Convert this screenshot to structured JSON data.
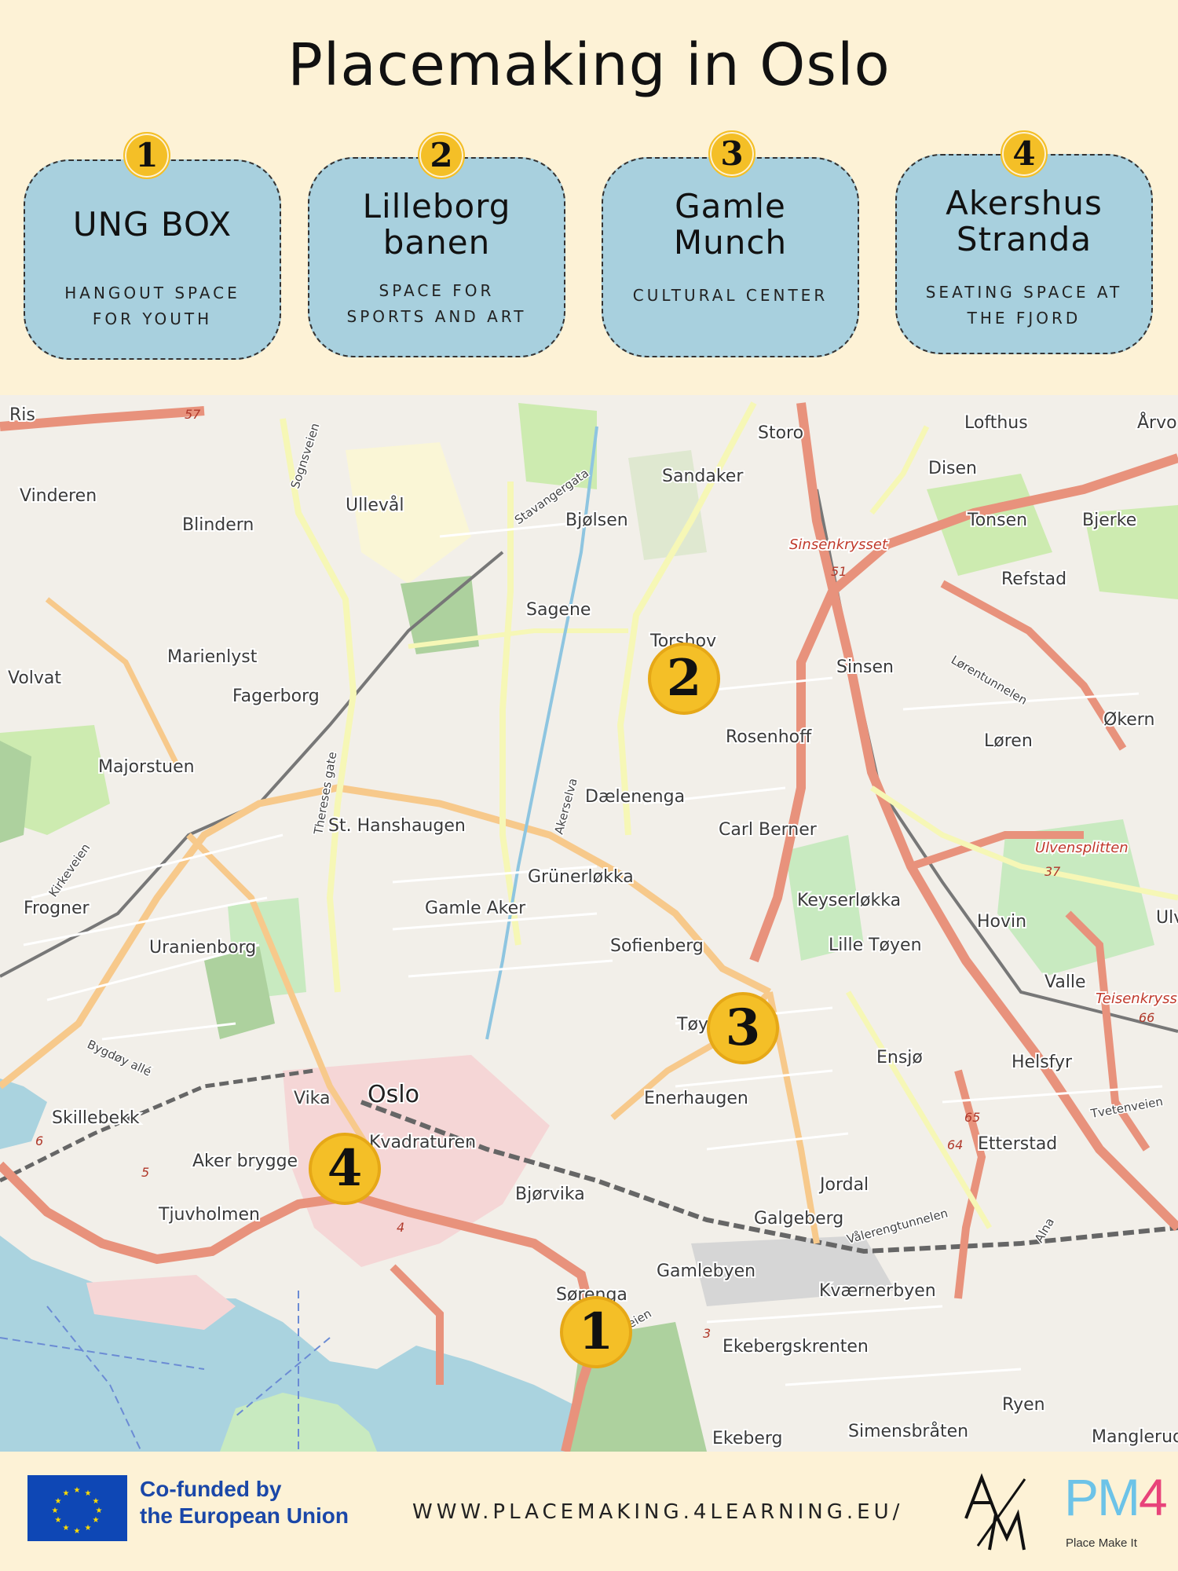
{
  "title": "Placemaking in Oslo",
  "cards": [
    {
      "number": "1",
      "name": "UNG BOX",
      "description": [
        "HANGOUT SPACE",
        "FOR YOUTH"
      ]
    },
    {
      "number": "2",
      "name": [
        "Lilleborg",
        "banen"
      ],
      "description": [
        "SPACE FOR",
        "SPORTS AND ART"
      ]
    },
    {
      "number": "3",
      "name": [
        "Gamle",
        "Munch"
      ],
      "description": [
        "CULTURAL CENTER"
      ]
    },
    {
      "number": "4",
      "name": [
        "Akershus",
        "Stranda"
      ],
      "description": [
        "SEATING SPACE AT",
        "THE FJORD"
      ]
    }
  ],
  "map": {
    "markers": [
      {
        "number": "1",
        "near": "Sørenga"
      },
      {
        "number": "2",
        "near": "Torshov"
      },
      {
        "number": "3",
        "near": "Tøyen"
      },
      {
        "number": "4",
        "near": "Aker brygge"
      }
    ],
    "place_labels": [
      "Ris",
      "Storo",
      "Lofthus",
      "Årvo",
      "Disen",
      "Sandaker",
      "Vinderen",
      "Ullevål",
      "Bjølsen",
      "Sinsenkrysset",
      "Tonsen",
      "Bjerke",
      "Blindern",
      "Refstad",
      "Sagene",
      "Marienlyst",
      "Torshov",
      "Sinsen",
      "Volvat",
      "Fagerborg",
      "Økern",
      "Rosenhoff",
      "Løren",
      "Majorstuen",
      "Dælenenga",
      "St. Hanshaugen",
      "Carl Berner",
      "Ulvensplitten",
      "Grünerløkka",
      "Frogner",
      "Gamle Aker",
      "Keyserløkka",
      "Hovin",
      "Uranienborg",
      "Sofienberg",
      "Lille Tøyen",
      "Valle",
      "Teisenkryss",
      "Tøyen",
      "Ensjø",
      "Helsfyr",
      "Oslo",
      "Enerhaugen",
      "Skillebekk",
      "Vika",
      "Kvadraturen",
      "Etterstad",
      "Aker brygge",
      "Bjørvika",
      "Jordal",
      "Tjuvholmen",
      "Galgeberg",
      "Gamlebyen",
      "Sørenga",
      "Kværnerbyen",
      "Ekebergskrenten",
      "Ryen",
      "Ekeberg",
      "Simensbråten",
      "Manglerud",
      "Ulve"
    ],
    "road_labels": [
      "Sognsveien",
      "Stavangergata",
      "Thereses gate",
      "Akerselva",
      "Kirkeveien",
      "Bygdøy allé",
      "Lørentunnelen",
      "Vålerengtunnelen",
      "Tvetenveien",
      "Kongsveien",
      "Alna"
    ],
    "route_numbers": [
      "57",
      "51",
      "37",
      "66",
      "65",
      "64",
      "6",
      "5",
      "4",
      "3"
    ]
  },
  "footer": {
    "eu_line1": "Co-funded by",
    "eu_line2": "the European Union",
    "url": "WWW.PLACEMAKING.4LEARNING.EU/",
    "pm_caption": "Place Make It",
    "pm_letters": "PM",
    "pm_digit": "4"
  },
  "colors": {
    "background": "#fdf2d6",
    "card": "#a8d0de",
    "badge": "#f4bf27",
    "water": "#aad3df",
    "park": "#c8eac0",
    "motorway": "#e8927c",
    "primary_road": "#f7c98b",
    "secondary_road": "#f6f7b6",
    "eu_blue": "#1a47a8"
  }
}
